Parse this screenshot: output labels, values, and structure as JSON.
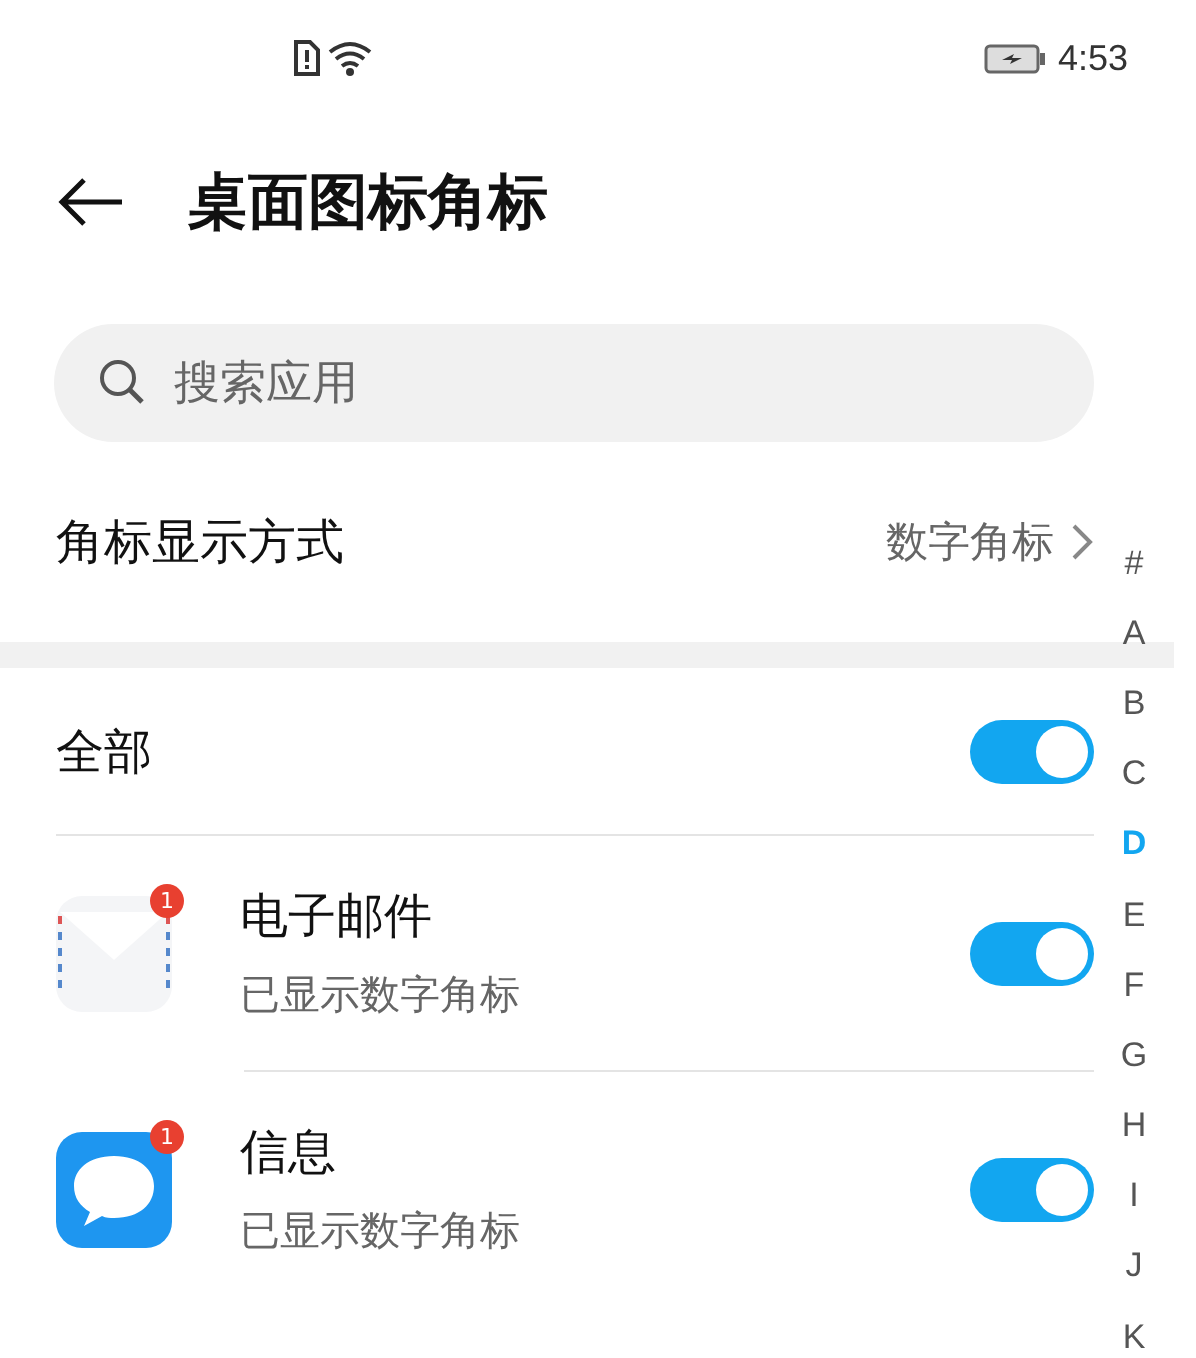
{
  "status_bar": {
    "time": "4:53"
  },
  "header": {
    "title": "桌面图标角标"
  },
  "search": {
    "placeholder": "搜索应用"
  },
  "badge_style": {
    "label": "角标显示方式",
    "value": "数字角标"
  },
  "all": {
    "label": "全部",
    "on": true
  },
  "apps": [
    {
      "kind": "mail",
      "name": "电子邮件",
      "subtitle": "已显示数字角标",
      "badge": "1",
      "on": true
    },
    {
      "kind": "message",
      "name": "信息",
      "subtitle": "已显示数字角标",
      "badge": "1",
      "on": true
    }
  ],
  "index": [
    {
      "label": "#",
      "selected": false
    },
    {
      "label": "A",
      "selected": false
    },
    {
      "label": "B",
      "selected": false
    },
    {
      "label": "C",
      "selected": false
    },
    {
      "label": "D",
      "selected": true
    },
    {
      "label": "E",
      "selected": false
    },
    {
      "label": "F",
      "selected": false
    },
    {
      "label": "G",
      "selected": false
    },
    {
      "label": "H",
      "selected": false
    },
    {
      "label": "I",
      "selected": false
    },
    {
      "label": "J",
      "selected": false
    },
    {
      "label": "K",
      "selected": false
    }
  ]
}
